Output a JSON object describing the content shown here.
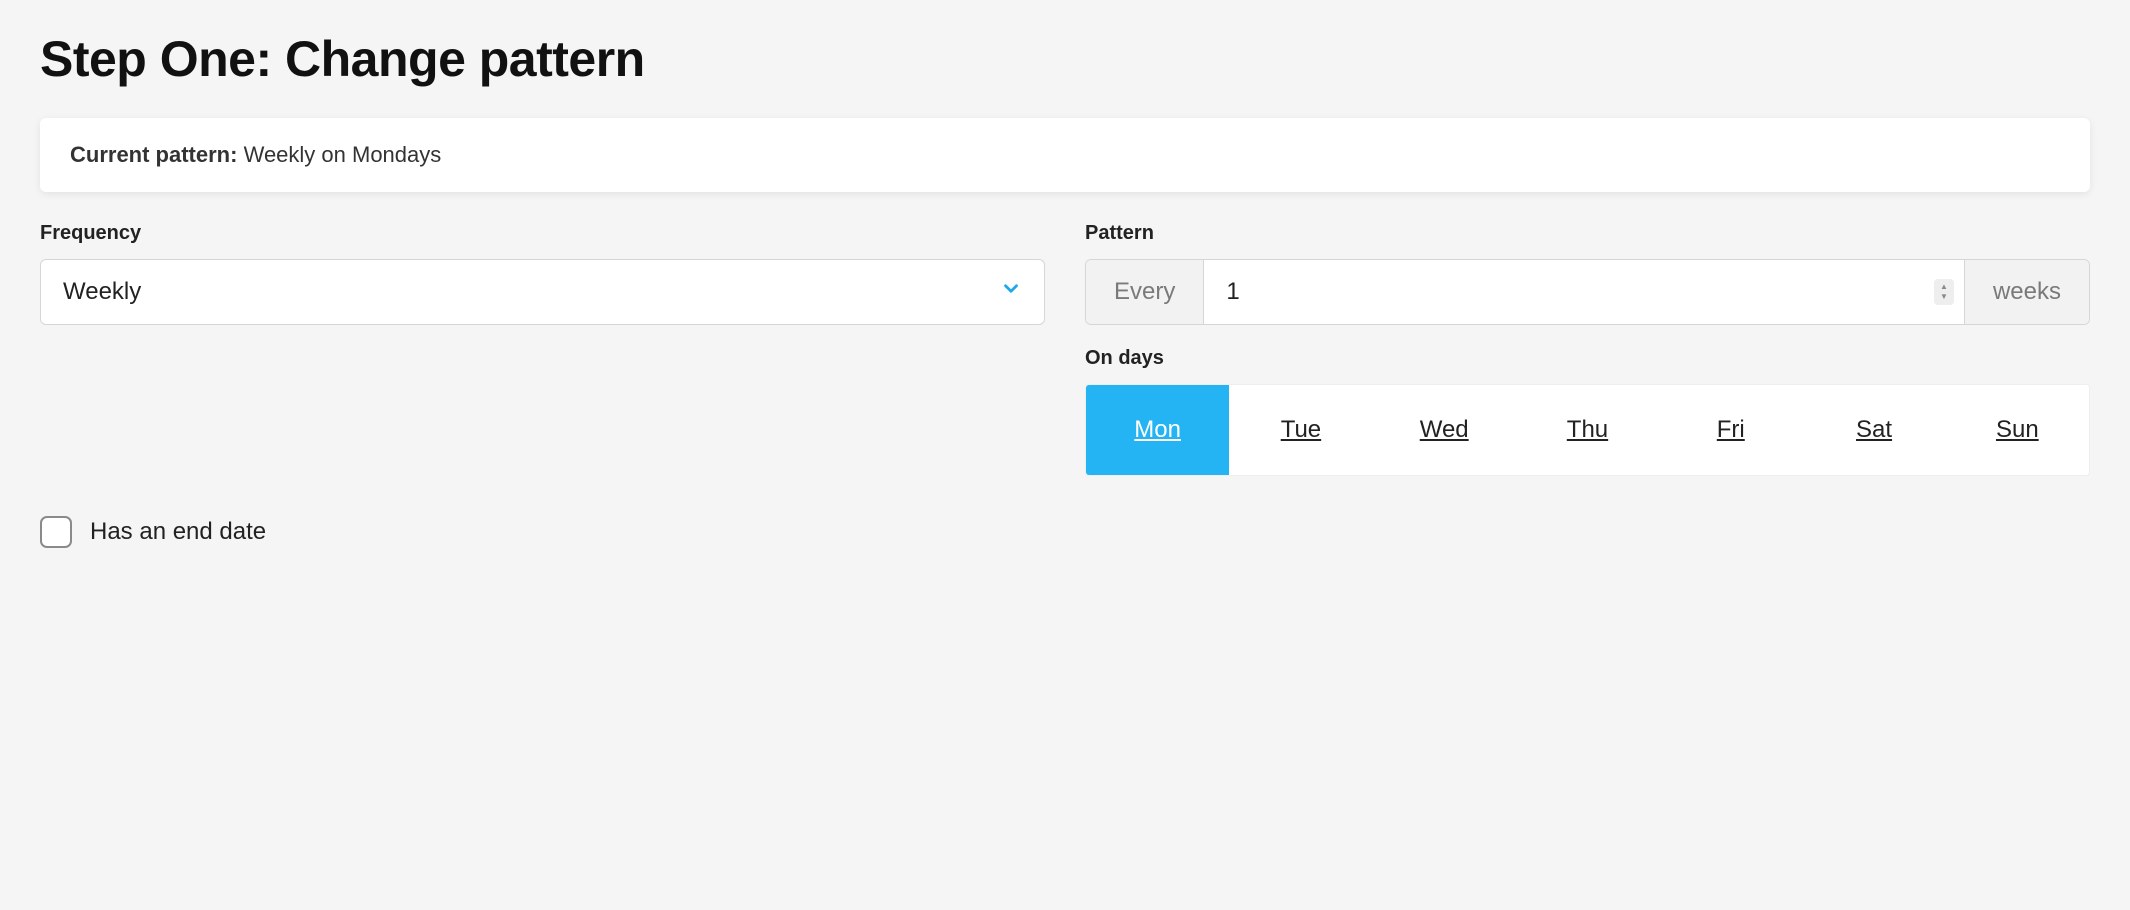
{
  "title": "Step One: Change pattern",
  "current_pattern": {
    "label": "Current pattern:",
    "value": "Weekly on Mondays"
  },
  "frequency": {
    "label": "Frequency",
    "selected": "Weekly"
  },
  "pattern": {
    "label": "Pattern",
    "prefix": "Every",
    "value": "1",
    "suffix": "weeks"
  },
  "on_days": {
    "label": "On days",
    "days": [
      {
        "label": "Mon",
        "selected": true
      },
      {
        "label": "Tue",
        "selected": false
      },
      {
        "label": "Wed",
        "selected": false
      },
      {
        "label": "Thu",
        "selected": false
      },
      {
        "label": "Fri",
        "selected": false
      },
      {
        "label": "Sat",
        "selected": false
      },
      {
        "label": "Sun",
        "selected": false
      }
    ]
  },
  "end_date": {
    "label": "Has an end date",
    "checked": false
  }
}
